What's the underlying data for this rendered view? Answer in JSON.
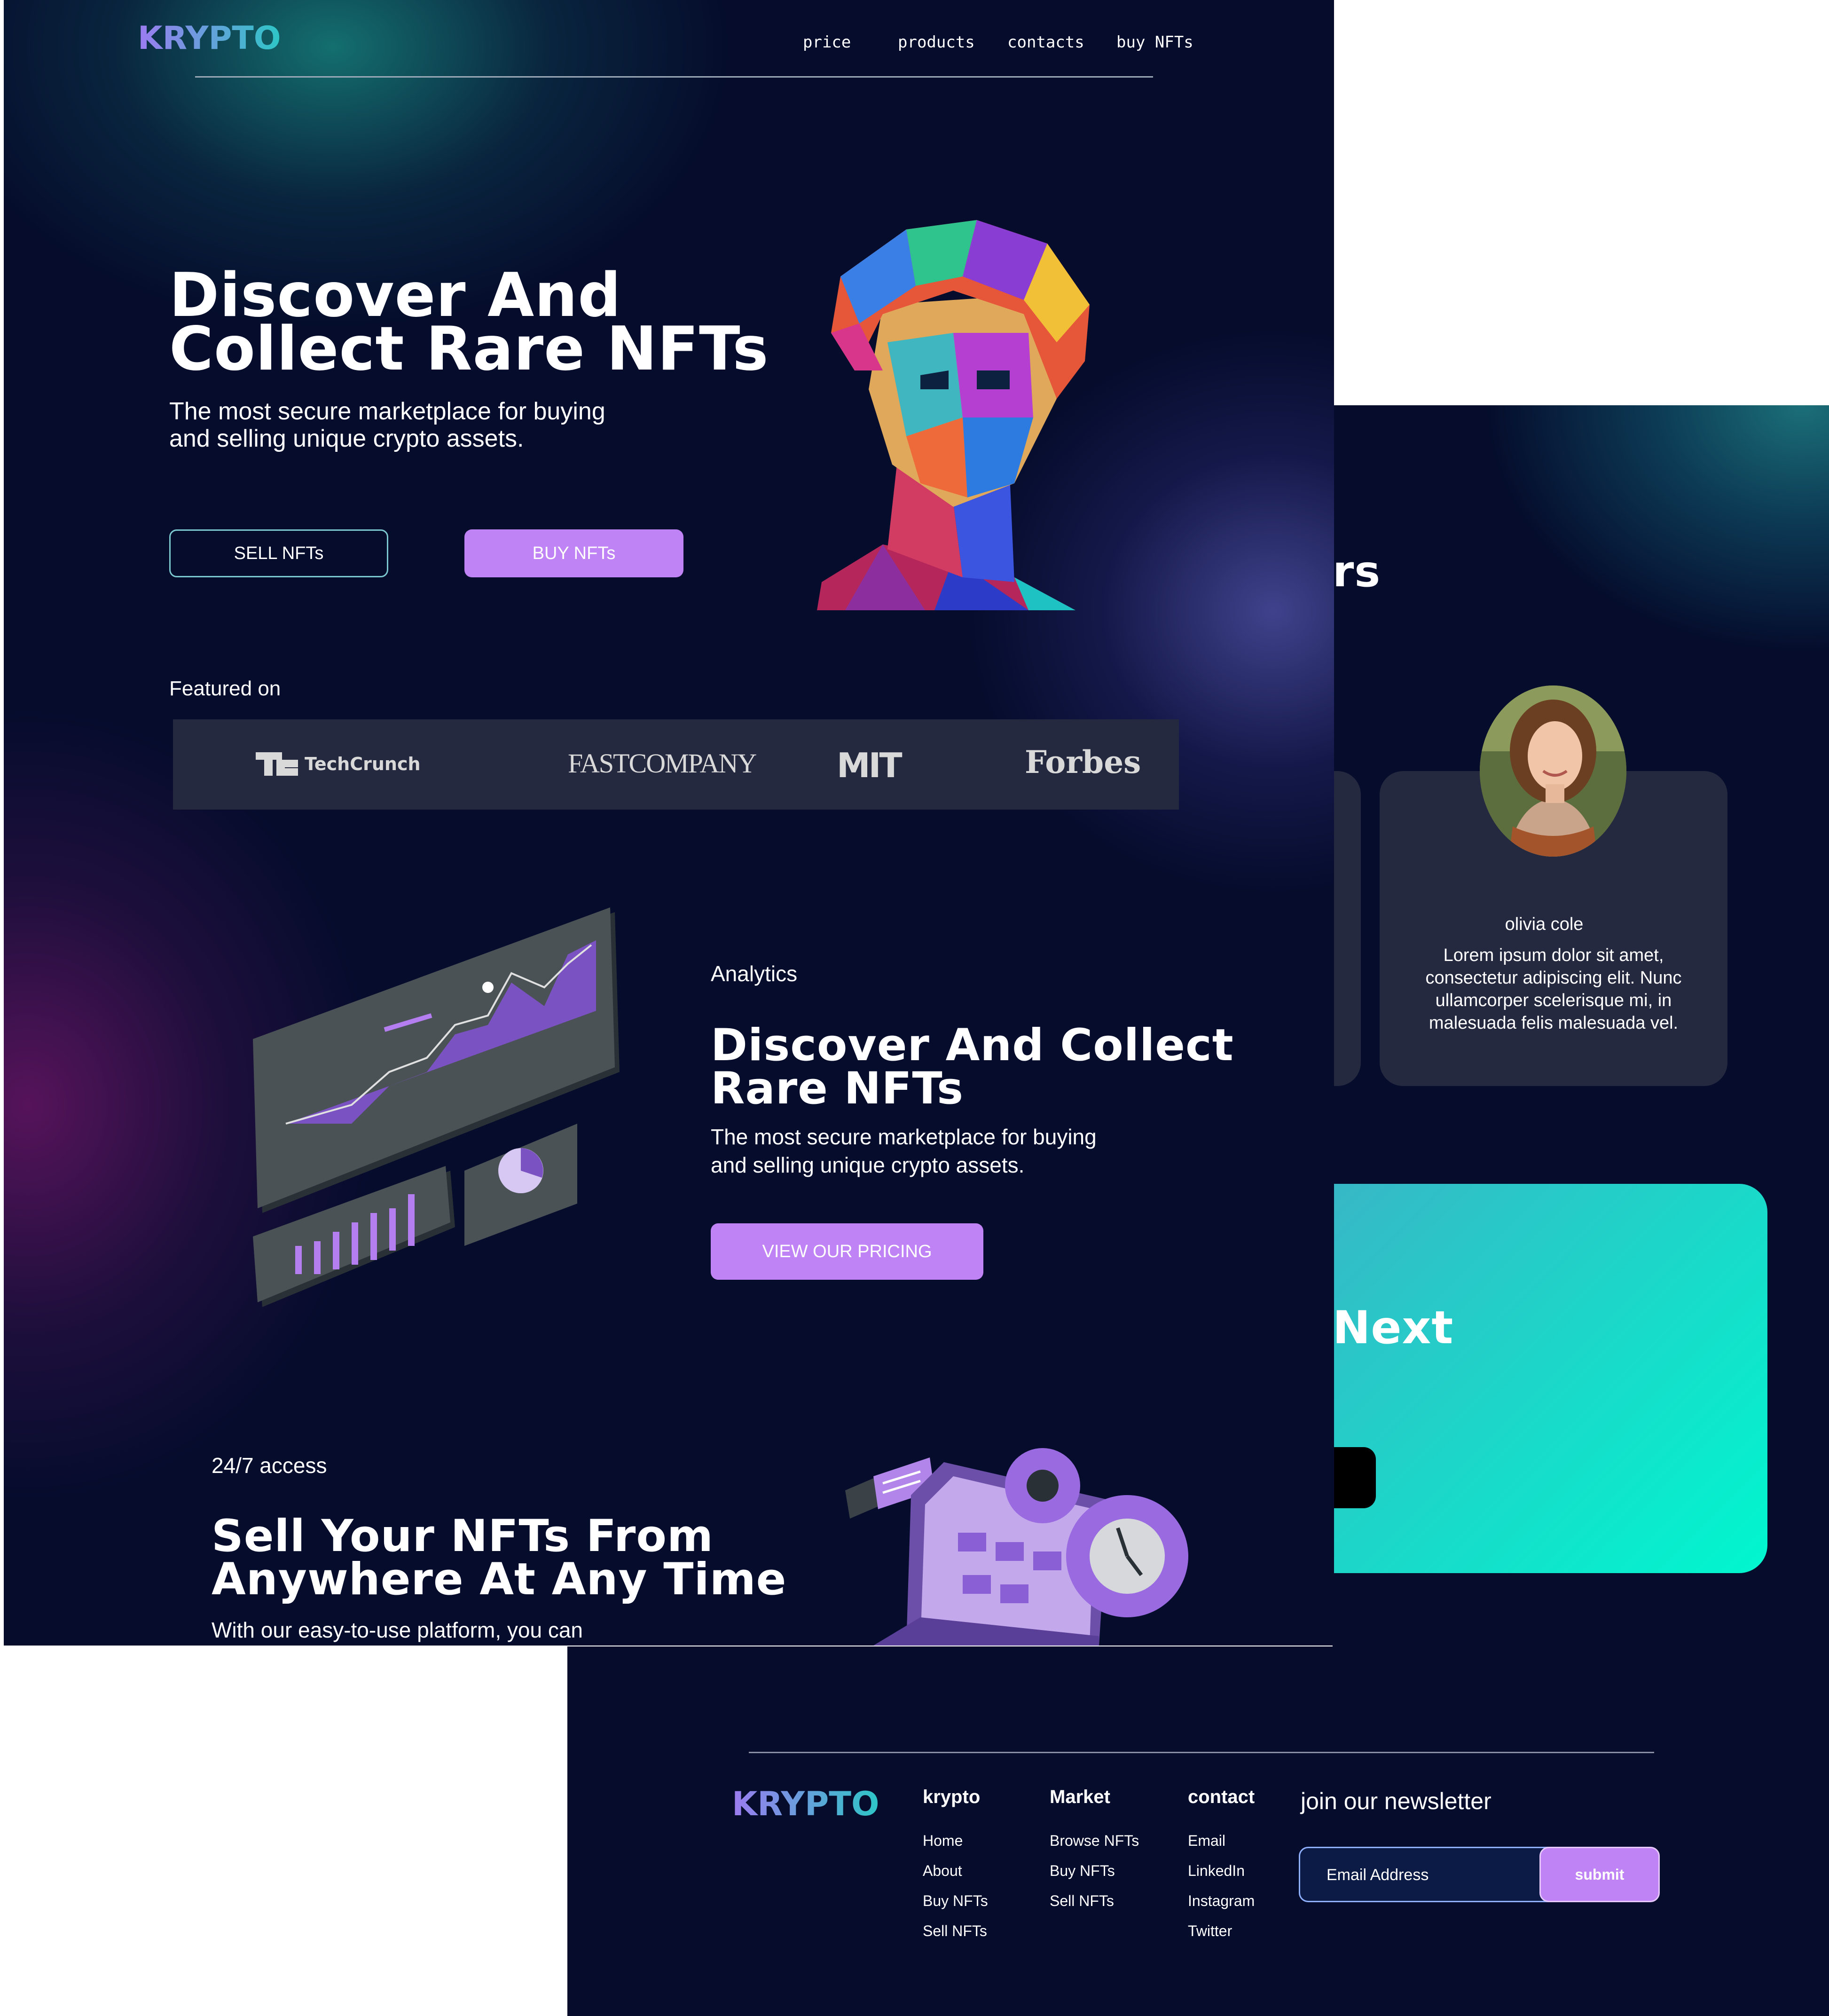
{
  "front": {
    "logo": "KRYPTO",
    "nav": [
      "price",
      "products",
      "contacts",
      "buy NFTs"
    ],
    "hero": {
      "title_line1": "Discover And",
      "title_line2": "Collect Rare NFTs",
      "subtitle_line1": "The most secure marketplace for buying",
      "subtitle_line2": "and selling unique crypto assets.",
      "sell_button": "SELL NFTs",
      "buy_button": "BUY NFTs"
    },
    "featured": {
      "label": "Featured on",
      "logos": [
        "TechCrunch",
        "FASTCOMPANY",
        "MIT",
        "Forbes"
      ]
    },
    "analytics": {
      "eyebrow": "Analytics",
      "title_line1": "Discover And Collect",
      "title_line2": "Rare NFTs",
      "text_line1": "The most secure marketplace for buying",
      "text_line2": "and selling unique crypto assets.",
      "button": "VIEW OUR PRICING"
    },
    "access": {
      "eyebrow": "24/7 access",
      "title_line1": "Sell Your NFTs From",
      "title_line2": "Anywhere At Any Time",
      "text": "With our easy-to-use platform, you can"
    }
  },
  "back": {
    "heading_fragment": "rs",
    "testimonial": {
      "name": "olivia cole",
      "quote_line1": "Lorem ipsum dolor sit amet,",
      "quote_line2": "consectetur adipiscing elit. Nunc",
      "quote_line3": "ullamcorper scelerisque mi, in",
      "quote_line4": "malesuada felis malesuada vel."
    },
    "cta_fragment": "Next"
  },
  "footer": {
    "logo": "KRYPTO",
    "columns": [
      {
        "title": "krypto",
        "links": [
          "Home",
          "About",
          "Buy NFTs",
          "Sell NFTs"
        ]
      },
      {
        "title": "Market",
        "links": [
          "Browse NFTs",
          "Buy NFTs",
          "Sell NFTs"
        ]
      },
      {
        "title": "contact",
        "links": [
          "Email",
          "LinkedIn",
          "Instagram",
          "Twitter"
        ]
      }
    ],
    "newsletter": {
      "title": "join our newsletter",
      "placeholder": "Email Address",
      "submit": "submit"
    }
  },
  "colors": {
    "background": "#050c2c",
    "accent_purple": "#c083f5",
    "accent_teal": "#2dc6c6",
    "card": "#25293f",
    "cta_gradient_start": "#3cb3c6",
    "cta_gradient_end": "#00f7cf"
  }
}
